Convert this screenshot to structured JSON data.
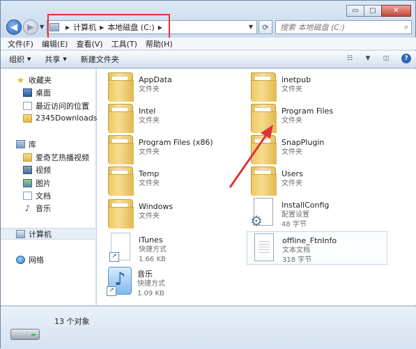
{
  "window": {
    "minimize_glyph": "▭",
    "maximize_glyph": "▢",
    "close_glyph": "✕"
  },
  "address": {
    "crumbs": [
      "计算机",
      "本地磁盘 (C:)"
    ]
  },
  "search": {
    "placeholder": "搜索 本地磁盘 (C:)"
  },
  "menu": [
    "文件(F)",
    "编辑(E)",
    "查看(V)",
    "工具(T)",
    "帮助(H)"
  ],
  "toolbar": {
    "organize": "组织",
    "share": "共享",
    "new_folder": "新建文件夹"
  },
  "nav": {
    "favorites": "收藏夹",
    "desktop": "桌面",
    "recent": "最近访问的位置",
    "downloads": "2345Downloads",
    "libraries": "库",
    "iqiyi": "爱奇艺热播视频",
    "videos": "视频",
    "pictures": "图片",
    "documents": "文档",
    "music": "音乐",
    "computer": "计算机",
    "network": "网络"
  },
  "items": [
    {
      "name": "AppData",
      "sub": "文件夹",
      "sub2": ""
    },
    {
      "name": "inetpub",
      "sub": "文件夹",
      "sub2": ""
    },
    {
      "name": "Intel",
      "sub": "文件夹",
      "sub2": ""
    },
    {
      "name": "Program Files",
      "sub": "文件夹",
      "sub2": ""
    },
    {
      "name": "Program Files (x86)",
      "sub": "文件夹",
      "sub2": ""
    },
    {
      "name": "SnapPlugin",
      "sub": "文件夹",
      "sub2": ""
    },
    {
      "name": "Temp",
      "sub": "文件夹",
      "sub2": ""
    },
    {
      "name": "Users",
      "sub": "文件夹",
      "sub2": ""
    },
    {
      "name": "Windows",
      "sub": "文件夹",
      "sub2": ""
    },
    {
      "name": "InstallConfig",
      "sub": "配置设置",
      "sub2": "48 字节"
    },
    {
      "name": "iTunes",
      "sub": "快捷方式",
      "sub2": "1.66 KB"
    },
    {
      "name": "offline_FtnInfo",
      "sub": "文本文档",
      "sub2": "318 字节"
    },
    {
      "name": "音乐",
      "sub": "快捷方式",
      "sub2": "1.09 KB"
    }
  ],
  "status": {
    "count": "13 个对象"
  },
  "colors": {
    "highlight_box": "#e03333",
    "arrow": "#e03333"
  }
}
